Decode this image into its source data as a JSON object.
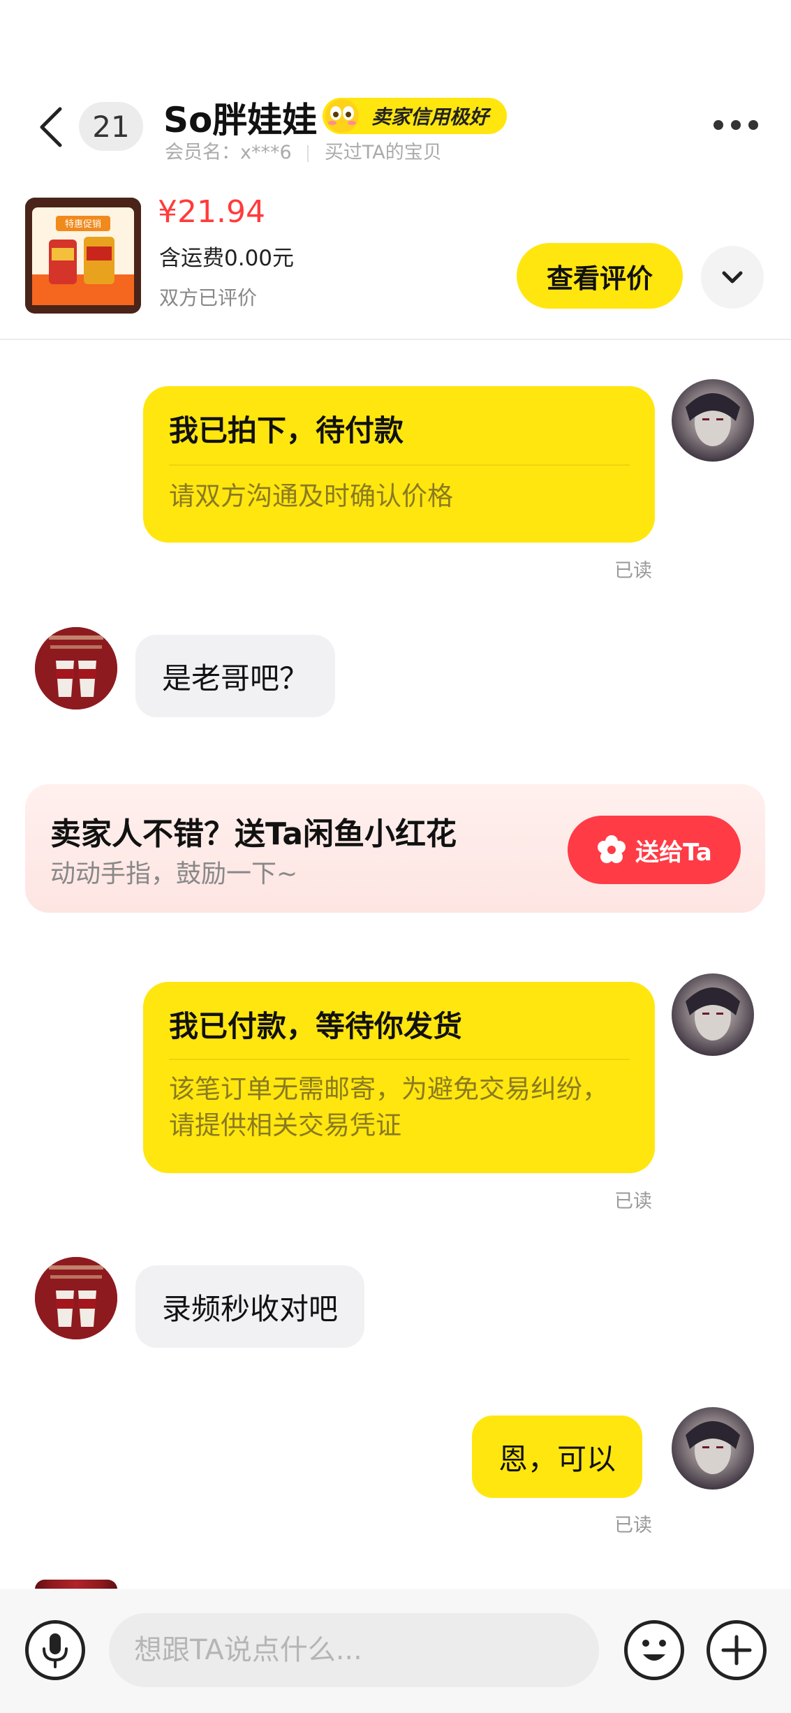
{
  "header": {
    "unread_count": "21",
    "seller_name": "So胖娃娃",
    "credit_badge": "卖家信用极好",
    "member_label": "会员名：x***6",
    "bought_label": "买过TA的宝贝",
    "icons": {
      "back": "back-arrow-icon",
      "more": "more-dots-icon",
      "badge": "eyes-emoji-icon"
    }
  },
  "product": {
    "price": "¥21.94",
    "shipping": "含运费0.00元",
    "status": "双方已评价",
    "view_review_button": "查看评价",
    "thumbnail_text": "特惠促销"
  },
  "messages": [
    {
      "side": "out",
      "type": "card",
      "title": "我已拍下，待付款",
      "body": "请双方沟通及时确认价格",
      "read": "已读"
    },
    {
      "side": "in",
      "type": "text",
      "text": "是老哥吧？"
    },
    {
      "side": "out",
      "type": "card",
      "title": "我已付款，等待你发货",
      "body": "该笔订单无需邮寄，为避免交易纠纷，请提供相关交易凭证",
      "read": "已读"
    },
    {
      "side": "in",
      "type": "text",
      "text": "录频秒收对吧"
    },
    {
      "side": "out",
      "type": "text",
      "text": "恩，可以",
      "read": "已读"
    }
  ],
  "flower_banner": {
    "title": "卖家人不错？送Ta闲鱼小红花",
    "subtitle": "动动手指，鼓励一下~",
    "button": "送给Ta",
    "icon": "flower-icon"
  },
  "composer": {
    "placeholder": "想跟TA说点什么...",
    "icons": {
      "voice": "microphone-icon",
      "emoji": "smiley-icon",
      "more": "plus-icon"
    }
  },
  "colors": {
    "accent_yellow": "#ffe60f",
    "price_red": "#ff3b3b",
    "flower_button_red": "#ff3b45"
  }
}
